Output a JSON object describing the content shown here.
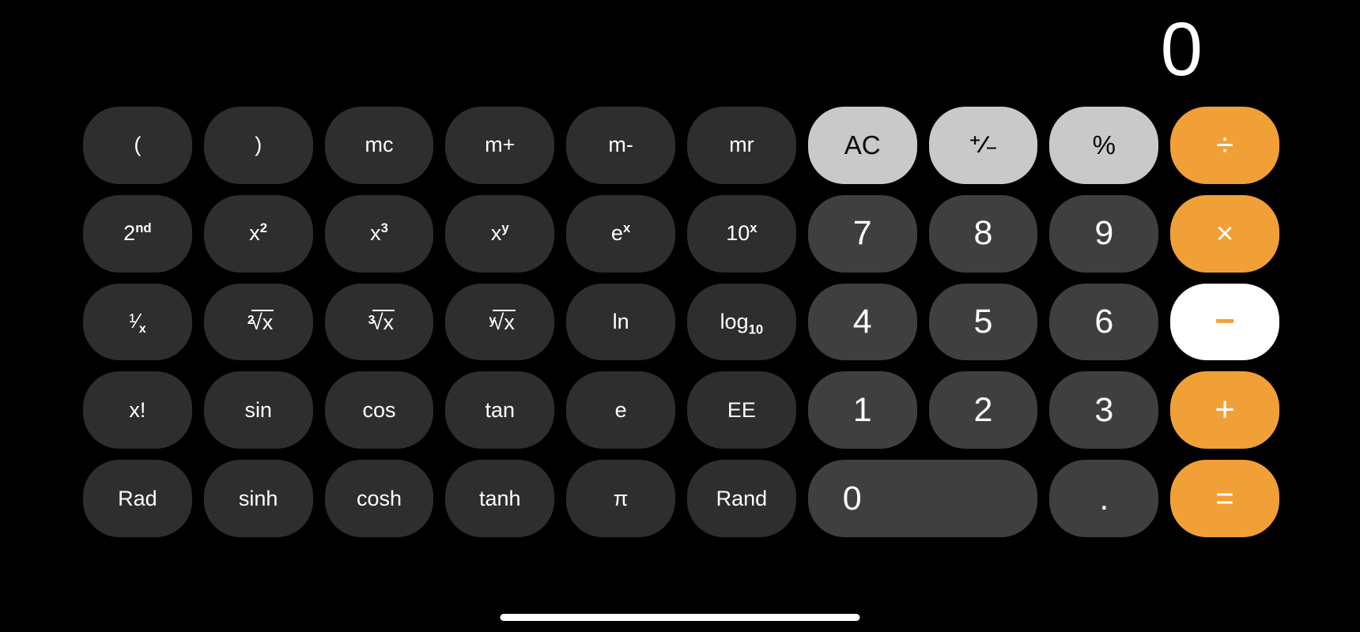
{
  "app": {
    "name": "Calculator",
    "mode": "scientific",
    "orientation": "landscape"
  },
  "theme": {
    "background": "#000000",
    "function_key_bg": "#2e2e2e",
    "number_key_bg": "#3f3f3f",
    "utility_key_bg": "#c9c9c9",
    "operator_key_bg": "#f0a037",
    "operator_selected_bg": "#ffffff",
    "operator_selected_fg": "#f0a037",
    "text_light": "#ffffff",
    "text_dark": "#0a0a0a"
  },
  "display": {
    "value": "0",
    "align": "right"
  },
  "keypad": {
    "rows": [
      [
        {
          "id": "open-paren",
          "label": "(",
          "kind": "func",
          "glyph": "plain"
        },
        {
          "id": "close-paren",
          "label": ")",
          "kind": "func",
          "glyph": "plain"
        },
        {
          "id": "mc",
          "label": "mc",
          "kind": "func",
          "glyph": "plain"
        },
        {
          "id": "m-plus",
          "label": "m+",
          "kind": "func",
          "glyph": "plain"
        },
        {
          "id": "m-minus",
          "label": "m-",
          "kind": "func",
          "glyph": "plain"
        },
        {
          "id": "mr",
          "label": "mr",
          "kind": "func",
          "glyph": "plain"
        },
        {
          "id": "all-clear",
          "label": "AC",
          "kind": "util",
          "glyph": "plain"
        },
        {
          "id": "sign-toggle",
          "label": "+/-",
          "kind": "util",
          "glyph": "plusminus"
        },
        {
          "id": "percent",
          "label": "%",
          "kind": "util",
          "glyph": "plain"
        },
        {
          "id": "divide",
          "label": "÷",
          "kind": "op",
          "glyph": "divide",
          "selected": false
        }
      ],
      [
        {
          "id": "second",
          "label": "2nd",
          "kind": "func",
          "glyph": "super",
          "base": "2",
          "exp": "nd"
        },
        {
          "id": "x-squared",
          "label": "x²",
          "kind": "func",
          "glyph": "super",
          "base": "x",
          "exp": "2"
        },
        {
          "id": "x-cubed",
          "label": "x³",
          "kind": "func",
          "glyph": "super",
          "base": "x",
          "exp": "3"
        },
        {
          "id": "x-to-y",
          "label": "xʸ",
          "kind": "func",
          "glyph": "super",
          "base": "x",
          "exp": "y"
        },
        {
          "id": "e-to-x",
          "label": "eˣ",
          "kind": "func",
          "glyph": "super",
          "base": "e",
          "exp": "x"
        },
        {
          "id": "ten-to-x",
          "label": "10ˣ",
          "kind": "func",
          "glyph": "super",
          "base": "10",
          "exp": "x"
        },
        {
          "id": "digit-7",
          "label": "7",
          "kind": "num",
          "glyph": "plain"
        },
        {
          "id": "digit-8",
          "label": "8",
          "kind": "num",
          "glyph": "plain"
        },
        {
          "id": "digit-9",
          "label": "9",
          "kind": "num",
          "glyph": "plain"
        },
        {
          "id": "multiply",
          "label": "×",
          "kind": "op",
          "glyph": "times",
          "selected": false
        }
      ],
      [
        {
          "id": "reciprocal",
          "label": "1/x",
          "kind": "func",
          "glyph": "reciprocal"
        },
        {
          "id": "sqrt-2",
          "label": "²√x",
          "kind": "func",
          "glyph": "radical",
          "index": "2"
        },
        {
          "id": "sqrt-3",
          "label": "³√x",
          "kind": "func",
          "glyph": "radical",
          "index": "3"
        },
        {
          "id": "sqrt-y",
          "label": "ʸ√x",
          "kind": "func",
          "glyph": "radical",
          "index": "y"
        },
        {
          "id": "natural-log",
          "label": "ln",
          "kind": "func",
          "glyph": "plain"
        },
        {
          "id": "log-base-10",
          "label": "log₁₀",
          "kind": "func",
          "glyph": "sub",
          "base": "log",
          "idx": "10"
        },
        {
          "id": "digit-4",
          "label": "4",
          "kind": "num",
          "glyph": "plain"
        },
        {
          "id": "digit-5",
          "label": "5",
          "kind": "num",
          "glyph": "plain"
        },
        {
          "id": "digit-6",
          "label": "6",
          "kind": "num",
          "glyph": "plain"
        },
        {
          "id": "subtract",
          "label": "−",
          "kind": "op",
          "glyph": "minus",
          "selected": true
        }
      ],
      [
        {
          "id": "factorial",
          "label": "x!",
          "kind": "func",
          "glyph": "plain"
        },
        {
          "id": "sin",
          "label": "sin",
          "kind": "func",
          "glyph": "plain"
        },
        {
          "id": "cos",
          "label": "cos",
          "kind": "func",
          "glyph": "plain"
        },
        {
          "id": "tan",
          "label": "tan",
          "kind": "func",
          "glyph": "plain"
        },
        {
          "id": "euler-e",
          "label": "e",
          "kind": "func",
          "glyph": "plain"
        },
        {
          "id": "exponent-ee",
          "label": "EE",
          "kind": "func",
          "glyph": "plain"
        },
        {
          "id": "digit-1",
          "label": "1",
          "kind": "num",
          "glyph": "plain"
        },
        {
          "id": "digit-2",
          "label": "2",
          "kind": "num",
          "glyph": "plain"
        },
        {
          "id": "digit-3",
          "label": "3",
          "kind": "num",
          "glyph": "plain"
        },
        {
          "id": "add",
          "label": "+",
          "kind": "op",
          "glyph": "plus",
          "selected": false
        }
      ],
      [
        {
          "id": "rad",
          "label": "Rad",
          "kind": "func",
          "glyph": "plain"
        },
        {
          "id": "sinh",
          "label": "sinh",
          "kind": "func",
          "glyph": "plain"
        },
        {
          "id": "cosh",
          "label": "cosh",
          "kind": "func",
          "glyph": "plain"
        },
        {
          "id": "tanh",
          "label": "tanh",
          "kind": "func",
          "glyph": "plain"
        },
        {
          "id": "pi",
          "label": "π",
          "kind": "func",
          "glyph": "plain"
        },
        {
          "id": "rand",
          "label": "Rand",
          "kind": "func",
          "glyph": "plain"
        },
        {
          "id": "digit-0",
          "label": "0",
          "kind": "num",
          "glyph": "plain",
          "wide": true
        },
        {
          "id": "decimal",
          "label": ".",
          "kind": "num",
          "glyph": "plain"
        },
        {
          "id": "equals",
          "label": "=",
          "kind": "op",
          "glyph": "equals",
          "selected": false
        }
      ]
    ]
  },
  "system": {
    "home_indicator": "home-indicator-bar"
  }
}
